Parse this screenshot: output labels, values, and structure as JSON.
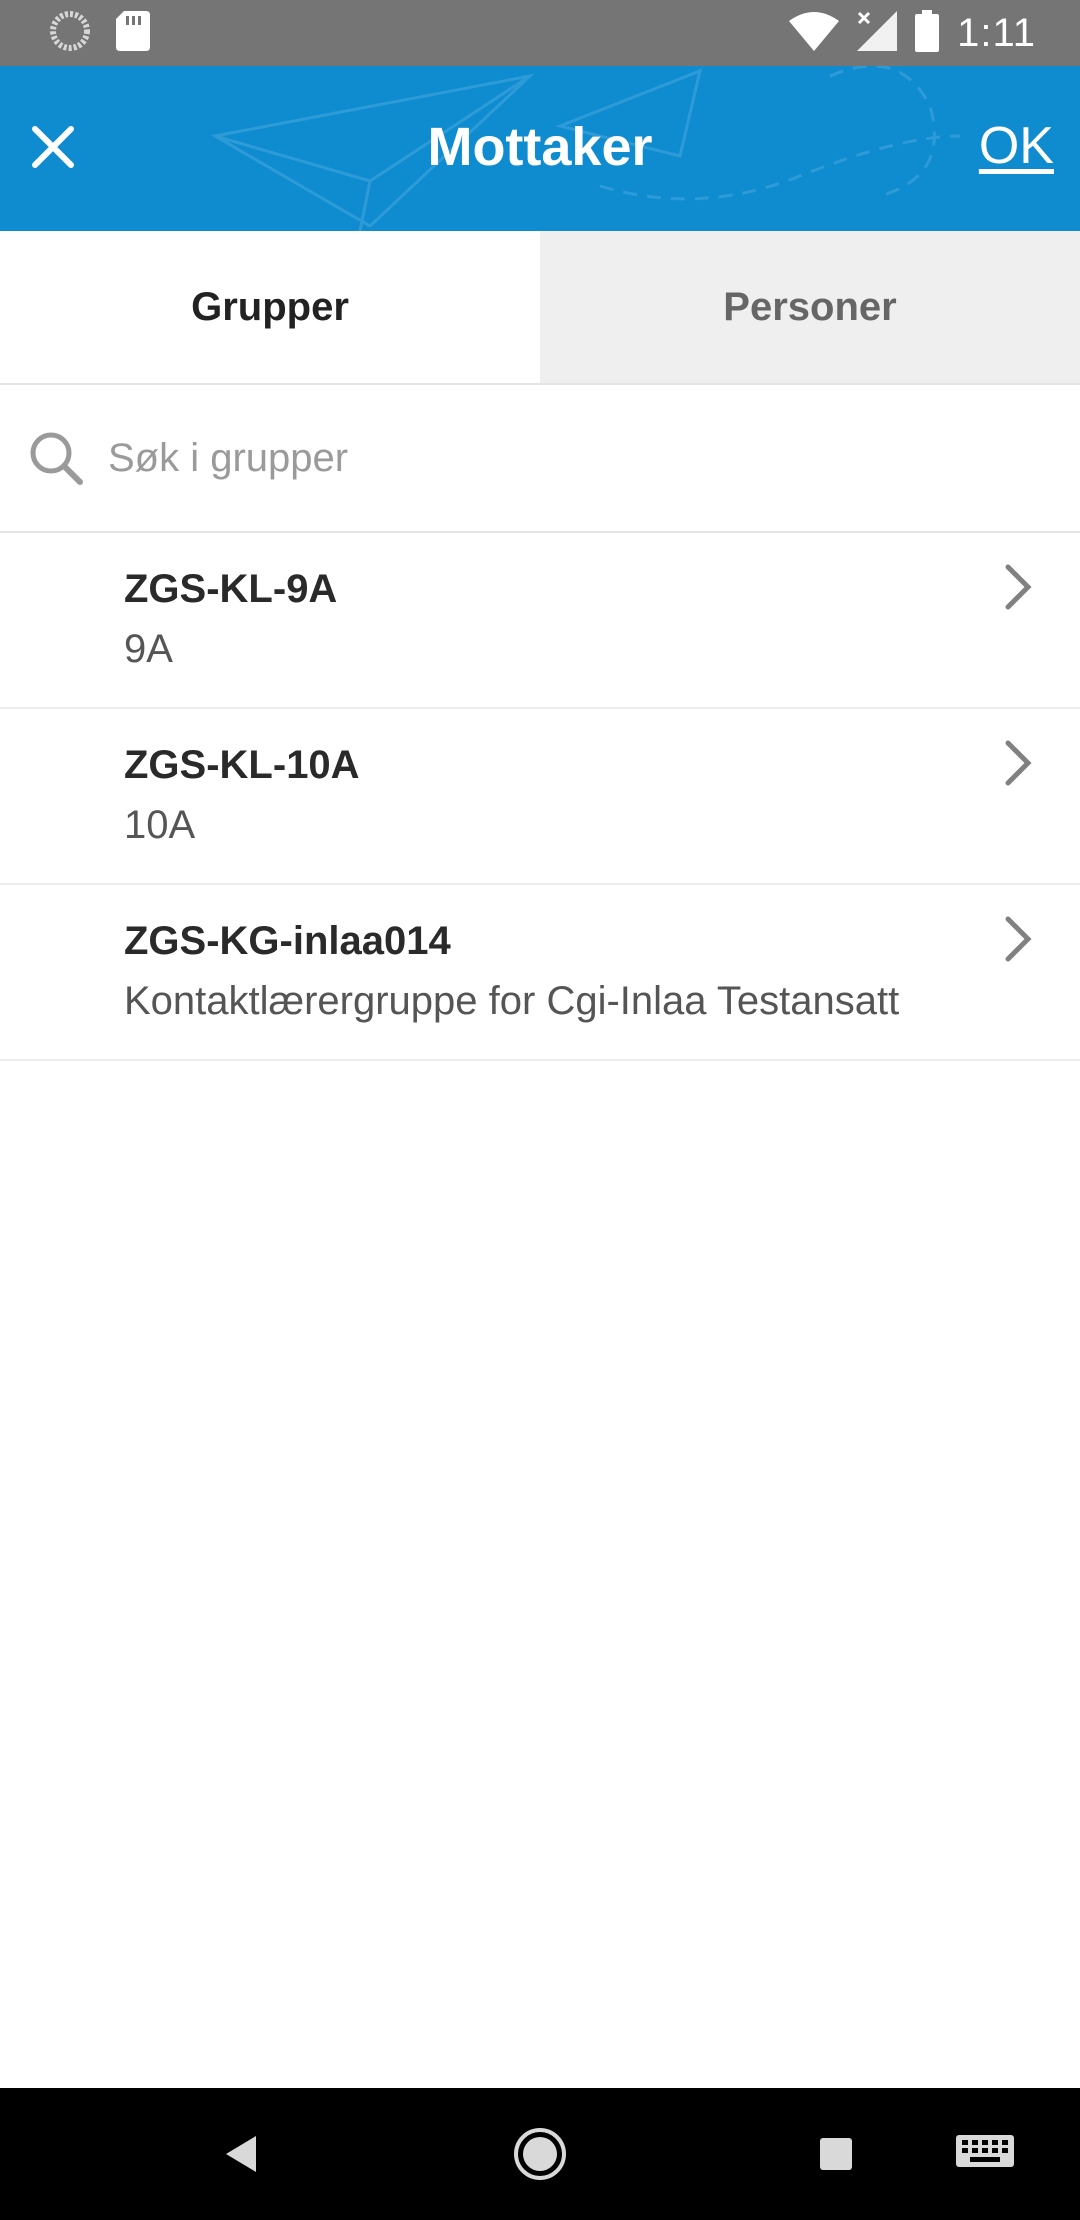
{
  "status_bar": {
    "time": "1:11",
    "icons": [
      "loading-icon",
      "sd-card-icon",
      "wifi-icon",
      "signal-icon",
      "battery-icon"
    ]
  },
  "app_bar": {
    "title": "Mottaker",
    "ok_label": "OK",
    "close_icon": "close-icon",
    "background_color": "#0f8bcf"
  },
  "tabs": [
    {
      "label": "Grupper",
      "active": true
    },
    {
      "label": "Personer",
      "active": false
    }
  ],
  "search": {
    "placeholder": "Søk i grupper",
    "value": ""
  },
  "groups": [
    {
      "title": "ZGS-KL-9A",
      "subtitle": "9A"
    },
    {
      "title": "ZGS-KL-10A",
      "subtitle": "10A"
    },
    {
      "title": "ZGS-KG-inlaa014",
      "subtitle": "Kontaktlærergruppe for Cgi-Inlaa Testansatt"
    }
  ],
  "nav_bar": {
    "buttons": [
      "back-icon",
      "home-icon",
      "recents-icon",
      "keyboard-icon"
    ]
  }
}
